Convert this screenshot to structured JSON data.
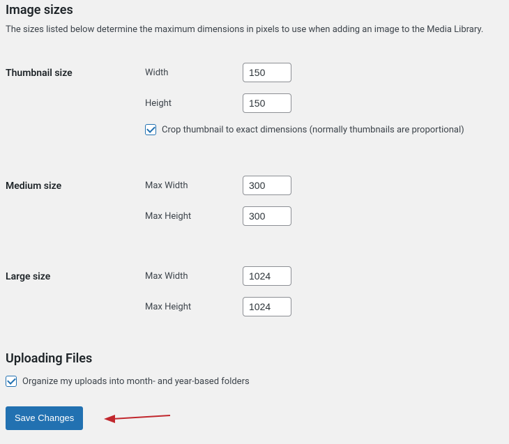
{
  "heading_sizes": "Image sizes",
  "description": "The sizes listed below determine the maximum dimensions in pixels to use when adding an image to the Media Library.",
  "thumbnail": {
    "title": "Thumbnail size",
    "width_label": "Width",
    "width_value": "150",
    "height_label": "Height",
    "height_value": "150",
    "crop_checked": true,
    "crop_label": "Crop thumbnail to exact dimensions (normally thumbnails are proportional)"
  },
  "medium": {
    "title": "Medium size",
    "width_label": "Max Width",
    "width_value": "300",
    "height_label": "Max Height",
    "height_value": "300"
  },
  "large": {
    "title": "Large size",
    "width_label": "Max Width",
    "width_value": "1024",
    "height_label": "Max Height",
    "height_value": "1024"
  },
  "heading_upload": "Uploading Files",
  "organize_uploads": {
    "checked": true,
    "label": "Organize my uploads into month- and year-based folders"
  },
  "save_button": "Save Changes"
}
